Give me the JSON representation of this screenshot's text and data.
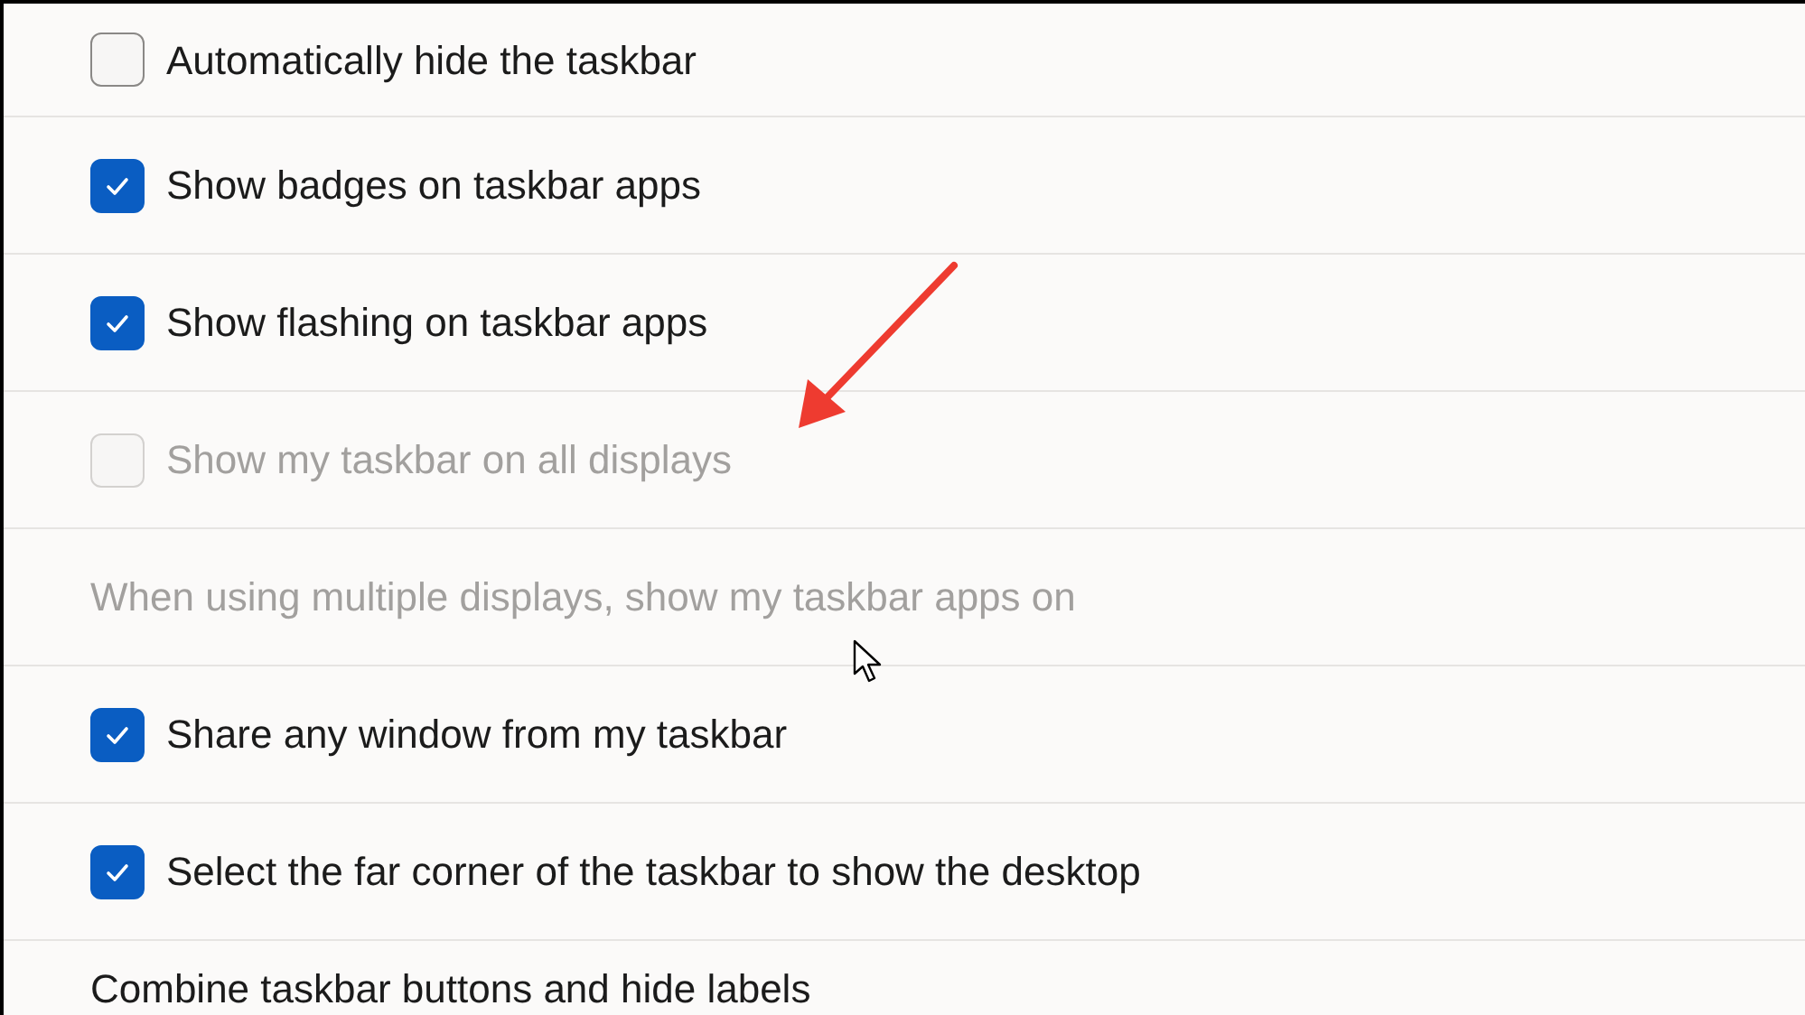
{
  "settings": [
    {
      "kind": "checkbox",
      "label": "Automatically hide the taskbar",
      "checked": false,
      "disabled": false
    },
    {
      "kind": "checkbox",
      "label": "Show badges on taskbar apps",
      "checked": true,
      "disabled": false
    },
    {
      "kind": "checkbox",
      "label": "Show flashing on taskbar apps",
      "checked": true,
      "disabled": false
    },
    {
      "kind": "checkbox",
      "label": "Show my taskbar on all displays",
      "checked": false,
      "disabled": true
    },
    {
      "kind": "label",
      "label": "When using multiple displays, show my taskbar apps on",
      "disabled": true
    },
    {
      "kind": "checkbox",
      "label": "Share any window from my taskbar",
      "checked": true,
      "disabled": false
    },
    {
      "kind": "checkbox",
      "label": "Select the far corner of the taskbar to show the desktop",
      "checked": true,
      "disabled": false
    },
    {
      "kind": "label",
      "label": "Combine taskbar buttons and hide labels",
      "disabled": false
    }
  ]
}
